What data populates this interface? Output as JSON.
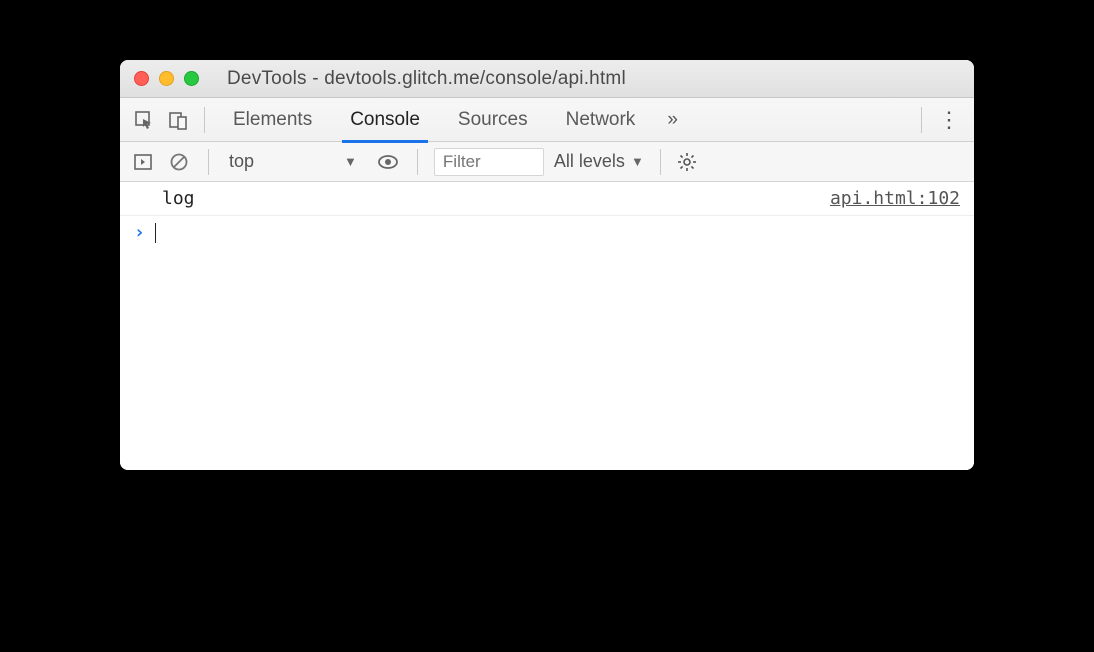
{
  "window": {
    "title": "DevTools - devtools.glitch.me/console/api.html"
  },
  "tabs": {
    "elements": "Elements",
    "console": "Console",
    "sources": "Sources",
    "network": "Network",
    "more_glyph": "»"
  },
  "toolbar": {
    "context": "top",
    "filter_placeholder": "Filter",
    "levels": "All levels"
  },
  "console": {
    "log_text": "log",
    "log_source": "api.html:102",
    "prompt_glyph": "›"
  }
}
